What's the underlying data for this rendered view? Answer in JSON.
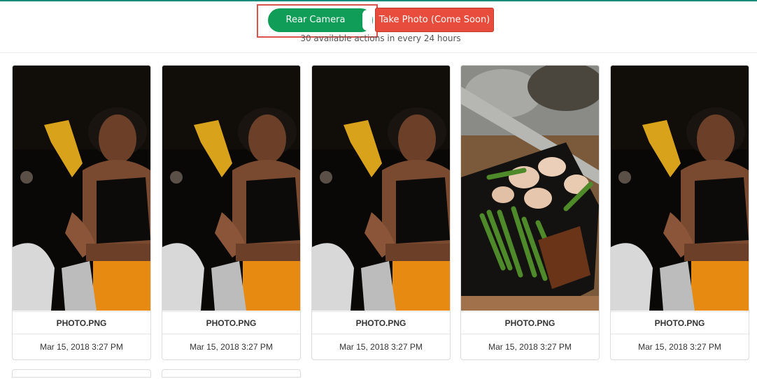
{
  "toolbar": {
    "camera_toggle_label": "Rear Camera",
    "take_photo_label": "Take Photo (Come Soon)",
    "actions_note": "30 available actions in every 24 hours"
  },
  "colors": {
    "accent_green": "#0f9d58",
    "danger_red": "#e74c3c",
    "highlight_border": "#d9534f"
  },
  "photos": [
    {
      "name": "PHOTO.PNG",
      "date": "Mar 15, 2018 3:27 PM",
      "image": "woman-night-photo"
    },
    {
      "name": "PHOTO.PNG",
      "date": "Mar 15, 2018 3:27 PM",
      "image": "woman-night-photo"
    },
    {
      "name": "PHOTO.PNG",
      "date": "Mar 15, 2018 3:27 PM",
      "image": "woman-night-photo"
    },
    {
      "name": "PHOTO.PNG",
      "date": "Mar 15, 2018 3:27 PM",
      "image": "food-plate-photo"
    },
    {
      "name": "PHOTO.PNG",
      "date": "Mar 15, 2018 3:27 PM",
      "image": "woman-night-photo"
    }
  ]
}
